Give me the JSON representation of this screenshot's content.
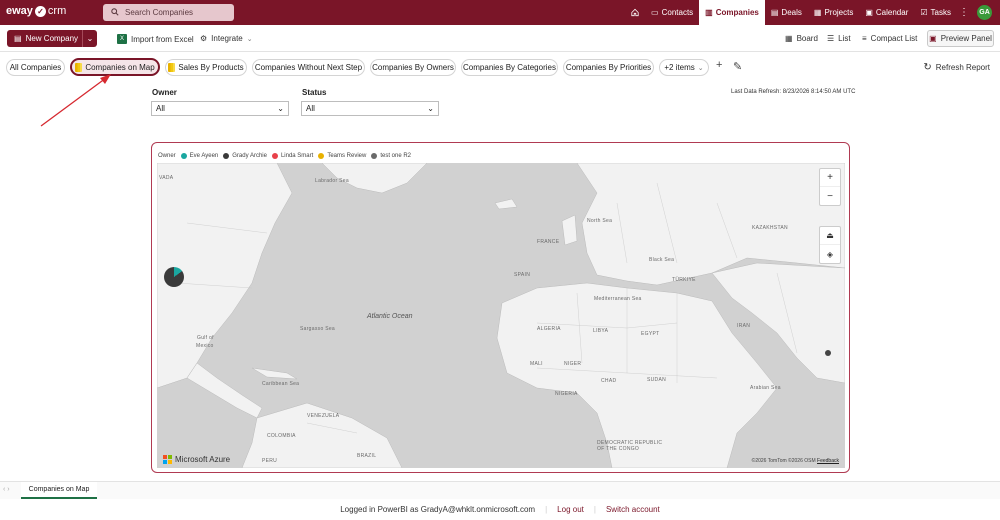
{
  "app": {
    "logo_eway": "eway",
    "logo_crm": "crm"
  },
  "search": {
    "label": "Search Companies"
  },
  "nav": [
    {
      "label": "Contacts",
      "icon": "contacts-icon",
      "active": false
    },
    {
      "label": "Companies",
      "icon": "companies-icon",
      "active": true
    },
    {
      "label": "Deals",
      "icon": "deals-icon",
      "active": false
    },
    {
      "label": "Projects",
      "icon": "projects-icon",
      "active": false
    },
    {
      "label": "Calendar",
      "icon": "calendar-icon",
      "active": false
    },
    {
      "label": "Tasks",
      "icon": "tasks-icon",
      "active": false
    }
  ],
  "user": {
    "initials": "GA"
  },
  "toolbar": {
    "new_company": "New Company",
    "import_excel": "Import from Excel",
    "integrate": "Integrate",
    "board": "Board",
    "list": "List",
    "compact_list": "Compact List",
    "preview_panel": "Preview Panel"
  },
  "report_tabs": [
    "All Companies",
    "Companies on Map",
    "Sales By Products",
    "Companies Without Next Step",
    "Companies By Owners",
    "Companies By Categories",
    "Companies By Priorities",
    "+2 items"
  ],
  "refresh_report": "Refresh Report",
  "filters": {
    "owner_label": "Owner",
    "owner_value": "All",
    "status_label": "Status",
    "status_value": "All"
  },
  "last_refresh": "Last Data Refresh: 8/23/2026 8:14:50 AM UTC",
  "map": {
    "legend_title": "Owner",
    "legend": [
      {
        "name": "Eve Ayeen",
        "color": "#1aa7a0"
      },
      {
        "name": "Grady Archie",
        "color": "#3a3a3a"
      },
      {
        "name": "Linda Smart",
        "color": "#e8414a"
      },
      {
        "name": "Teams Review",
        "color": "#e8b100"
      },
      {
        "name": "test one R2",
        "color": "#6a6a6a"
      }
    ],
    "labels": {
      "atlantic": "Atlantic Ocean",
      "gulf1": "Gulf of",
      "gulf2": "Mexico",
      "labrador": "Labrador Sea",
      "sargasso": "Sargasso Sea",
      "caribbean": "Caribbean Sea",
      "north_sea": "North Sea",
      "black_sea": "Black Sea",
      "mediterranean": "Mediterranean Sea",
      "arabian": "Arabian Sea",
      "spain": "SPAIN",
      "france": "FRANCE",
      "algeria": "ALGERIA",
      "libya": "LIBYA",
      "egypt": "EGYPT",
      "mali": "MALI",
      "niger": "NIGER",
      "chad": "CHAD",
      "sudan": "SUDAN",
      "nigeria": "NIGERIA",
      "drc": "DEMOCRATIC REPUBLIC OF THE CONGO",
      "turkey": "TÜRKIYE",
      "iran": "IRAN",
      "kazakhstan": "KAZAKHSTAN",
      "venezuela": "VENEZUELA",
      "colombia": "COLOMBIA",
      "brazil": "BRAZIL",
      "peru": "PERU",
      "nadia": "VADA"
    },
    "brand": "Microsoft Azure",
    "credit": "©2026 TomTom  ©2026 OSM",
    "feedback": "Feedback"
  },
  "page_tab": "Companies on Map",
  "footer": {
    "logged_in": "Logged in PowerBI as GradyA@whklt.onmicrosoft.com",
    "logout": "Log out",
    "switch": "Switch account"
  }
}
